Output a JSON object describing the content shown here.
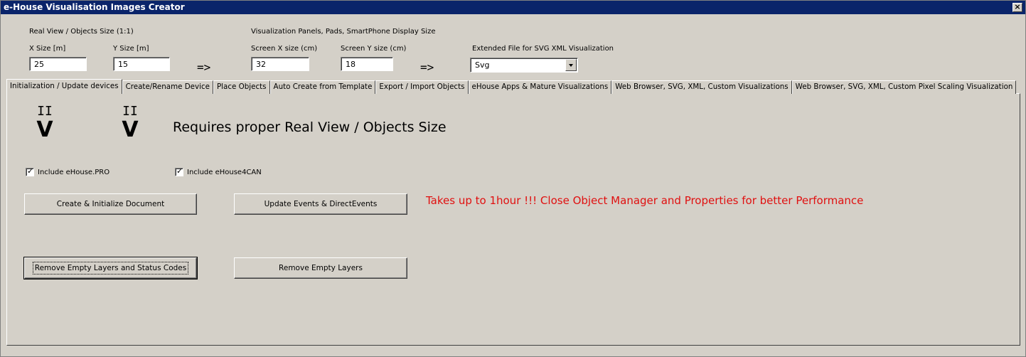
{
  "window": {
    "title": "e-House Visualisation Images Creator",
    "close_glyph": "×"
  },
  "header": {
    "real_view_label": "Real View / Objects Size (1:1)",
    "panels_label": "Visualization Panels, Pads, SmartPhone Display Size",
    "x_size_label": "X Size [m]",
    "x_size_value": "25",
    "y_size_label": "Y Size [m]",
    "y_size_value": "15",
    "arrow1": "=>",
    "screen_x_label": "Screen X size (cm)",
    "screen_x_value": "32",
    "screen_y_label": "Screen Y size (cm)",
    "screen_y_value": "18",
    "arrow2": "=>",
    "ext_label": "Extended File for SVG XML Visualization",
    "ext_value": "Svg"
  },
  "tabs": [
    {
      "label": "Initialization / Update devices"
    },
    {
      "label": "Create/Rename Device"
    },
    {
      "label": "Place Objects"
    },
    {
      "label": "Auto Create from Template"
    },
    {
      "label": "Export / Import Objects"
    },
    {
      "label": "eHouse Apps & Mature Visualizations"
    },
    {
      "label": "Web Browser, SVG, XML, Custom Visualizations"
    },
    {
      "label": "Web Browser, SVG, XML, Custom Pixel Scaling Visualization"
    }
  ],
  "panel": {
    "bars": "II",
    "v": "V",
    "requires_text": "Requires proper Real View / Objects Size",
    "chk_pro": "Include eHouse.PRO",
    "chk_can": "Include eHouse4CAN",
    "btn_create": "Create & Initialize Document",
    "btn_update": "Update Events & DirectEvents",
    "warning": "Takes up to 1hour !!!  Close Object Manager and Properties for better Performance",
    "btn_remove_status": "Remove Empty Layers and Status Codes",
    "btn_remove": "Remove Empty Layers"
  },
  "colors": {
    "titlebar": "#0a246a",
    "face": "#d4d0c8",
    "warning": "#e01010"
  }
}
